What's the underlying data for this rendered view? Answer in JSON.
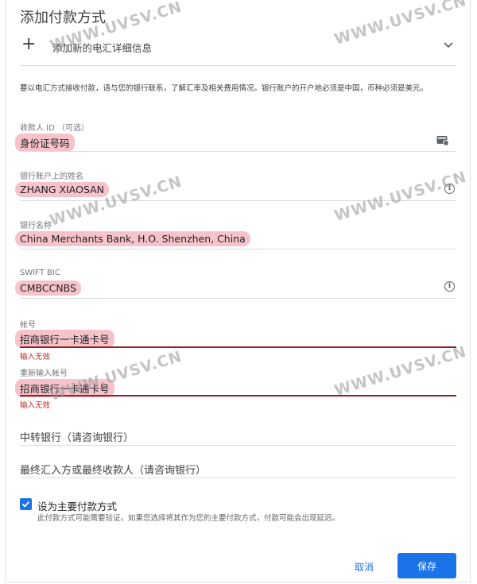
{
  "header": {
    "title": "添加付款方式",
    "add_label": "添加新的电汇详细信息",
    "plus_symbol": "+"
  },
  "info_text": "要以电汇方式接收付款，请与您的银行联系，了解汇率及相关费用情况。银行账户的开户地必须是中国，币种必须是美元。",
  "fields": {
    "payee_id": {
      "label": "收款人 ID （可选）",
      "value": "身份证号码",
      "icon": "card-icon"
    },
    "account_name": {
      "label": "银行账户上的姓名",
      "value": "ZHANG XIAOSAN",
      "icon": "info-icon"
    },
    "bank_name": {
      "label": "银行名称",
      "value": "China Merchants Bank, H.O. Shenzhen, China"
    },
    "swift": {
      "label": "SWIFT BIC",
      "value": "CMBCCNBS",
      "icon": "info-icon"
    },
    "account_no": {
      "label": "帐号",
      "value": "招商银行一卡通卡号",
      "error": "输入无效"
    },
    "account_no_confirm": {
      "label": "重新输入帐号",
      "value": "招商银行一卡通卡号",
      "error": "输入无效"
    },
    "intermediary_bank": {
      "label": "中转银行（请咨询银行）"
    },
    "final_payee": {
      "label": "最终汇入方或最终收款人（请咨询银行）"
    }
  },
  "primary": {
    "checked": true,
    "label": "设为主要付款方式",
    "note": "此付款方式可能需要验证。如果您选择将其作为您的主要付款方式，付款可能会出现延迟。"
  },
  "buttons": {
    "cancel": "取消",
    "save": "保存"
  },
  "watermark": "WWW.UVSV.CN",
  "colors": {
    "accent": "#1a73e8",
    "error": "#c5221f",
    "highlight": "#f7c3cb"
  }
}
